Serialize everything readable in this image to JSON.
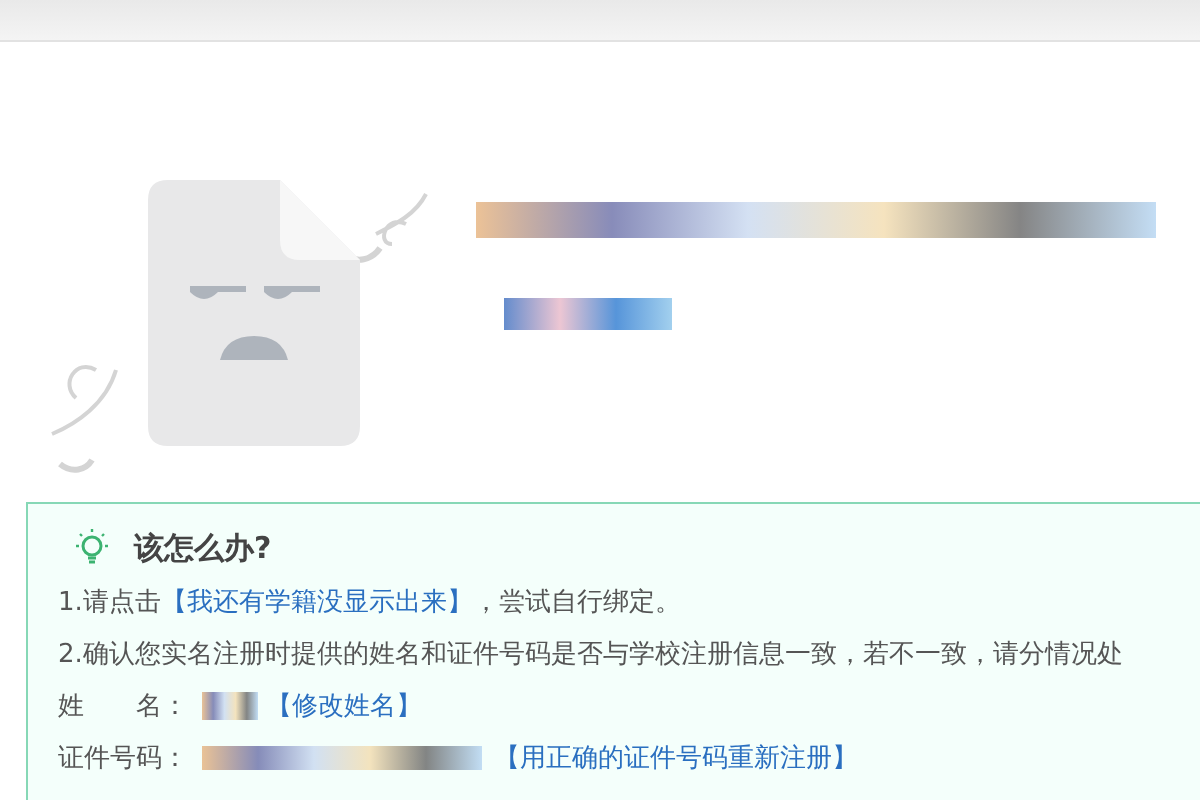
{
  "help": {
    "title": "该怎么办?",
    "steps": [
      {
        "kind": "link",
        "prefix": "1.请点击",
        "link": "【我还有学籍没显示出来】",
        "suffix": "，尝试自行绑定。"
      },
      {
        "kind": "text",
        "text": "2.确认您实名注册时提供的姓名和证件号码是否与学校注册信息一致，若不一致，请分情况处"
      }
    ],
    "fields": [
      {
        "label": "姓　　名：",
        "link": "【修改姓名】"
      },
      {
        "label": "证件号码：",
        "link": "【用正确的证件号码重新注册】"
      }
    ]
  }
}
